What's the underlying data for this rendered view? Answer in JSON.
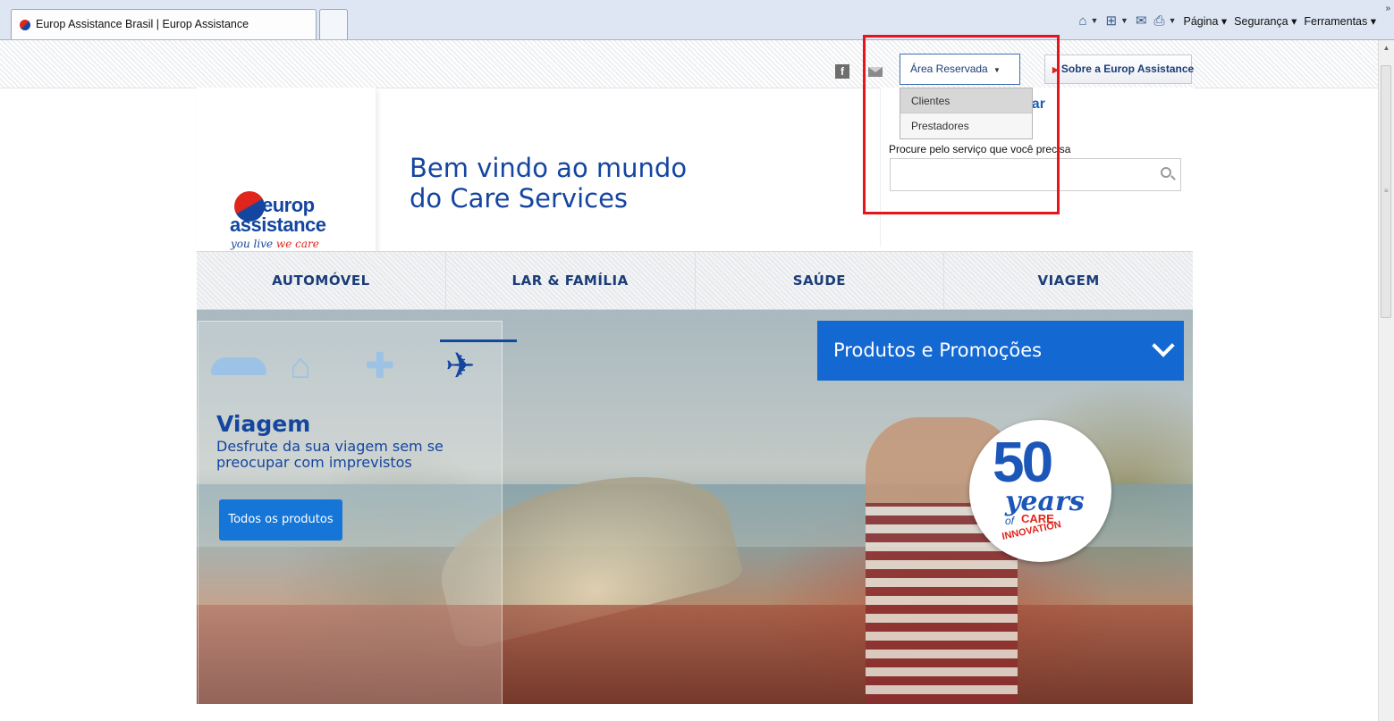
{
  "browser": {
    "tab_title": "Europ Assistance Brasil | Europ Assistance",
    "command_bar": {
      "pagina": "Página",
      "seguranca": "Segurança",
      "ferramentas": "Ferramentas",
      "more": "»"
    }
  },
  "header": {
    "area_reservada": "Área Reservada",
    "sobre": "Sobre a Europ Assistance",
    "dropdown": [
      "Clientes",
      "Prestadores"
    ],
    "buscar_fragment": "scar",
    "search_label": "Procure pelo serviço que você precisa",
    "facebook": "f"
  },
  "logo": {
    "line1": "europ",
    "line2": "assistance",
    "tag_a": "you live ",
    "tag_b": "we care"
  },
  "welcome": {
    "line1": "Bem vindo ao mundo",
    "line2": "do Care Services"
  },
  "nav": [
    "AUTOMÓVEL",
    "LAR & FAMÍLIA",
    "SAÚDE",
    "VIAGEM"
  ],
  "hero": {
    "category_title": "Viagem",
    "category_desc": "Desfrute da sua viagem sem se preocupar com imprevistos",
    "category_button": "Todos os produtos",
    "promo": "Produtos e Promoções",
    "badge": {
      "number": "50",
      "years": "years",
      "of": "of",
      "care": "CARE",
      "innovation": "INNOVATION"
    }
  },
  "colors": {
    "brand_blue": "#1446a0",
    "brand_red": "#e0261c",
    "promo_blue": "#1468d2",
    "highlight_red": "#e8141b"
  }
}
